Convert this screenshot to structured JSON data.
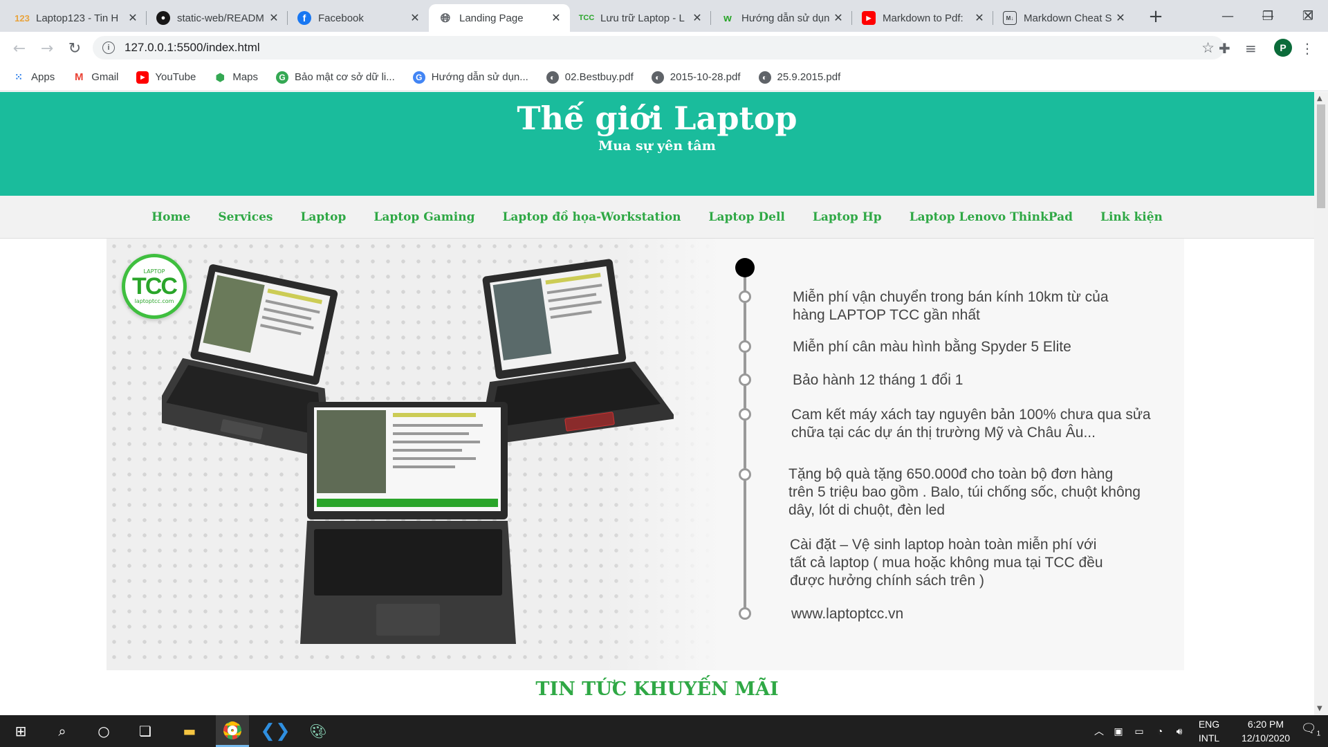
{
  "browser": {
    "tabs": [
      {
        "title": "Laptop123 - Tin H",
        "favicon": "laptop123-icon",
        "color": "#e8a33c"
      },
      {
        "title": "static-web/READM",
        "favicon": "github-icon",
        "color": "#181717"
      },
      {
        "title": "Facebook",
        "favicon": "facebook-icon",
        "color": "#1877f2"
      },
      {
        "title": "Landing Page",
        "favicon": "globe-icon",
        "color": "#5f6368",
        "active": true
      },
      {
        "title": "Lưu trữ Laptop - L",
        "favicon": "tcc-icon",
        "color": "#2aa52a"
      },
      {
        "title": "Hướng dẫn sử dụn",
        "favicon": "w-icon",
        "color": "#2aa52a"
      },
      {
        "title": "Markdown to Pdf:",
        "favicon": "youtube-icon",
        "color": "#ff0000"
      },
      {
        "title": "Markdown Cheat S",
        "favicon": "markdown-icon",
        "color": "#3c4043"
      }
    ],
    "url": "127.0.0.1:5500/index.html",
    "profile_initial": "P",
    "bookmarks": [
      {
        "label": "Apps",
        "icon": "apps-grid-icon"
      },
      {
        "label": "Gmail",
        "icon": "gmail-icon"
      },
      {
        "label": "YouTube",
        "icon": "youtube-icon"
      },
      {
        "label": "Maps",
        "icon": "maps-icon"
      },
      {
        "label": "Bảo mật cơ sở dữ li...",
        "icon": "green-g-icon"
      },
      {
        "label": "Hướng dẫn sử dụn...",
        "icon": "blue-g-icon"
      },
      {
        "label": "02.Bestbuy.pdf",
        "icon": "globe-icon"
      },
      {
        "label": "2015-10-28.pdf",
        "icon": "globe-icon"
      },
      {
        "label": "25.9.2015.pdf",
        "icon": "globe-icon"
      }
    ]
  },
  "site": {
    "title": "Thế giới Laptop",
    "subtitle": "Mua sự yên tâm",
    "nav": [
      "Home",
      "Services",
      "Laptop",
      "Laptop Gaming",
      "Laptop đồ họa-Workstation",
      "Laptop Dell",
      "Laptop Hp",
      "Laptop Lenovo ThinkPad",
      "Link kiện"
    ],
    "banner": {
      "logo_text": "TCC",
      "logo_top": "LAPTOP",
      "logo_sub": "laptoptcc.com",
      "features": [
        "Miễn phí vận chuyển trong bán kính 10km từ của hàng LAPTOP TCC gần nhất",
        "Miễn phí cân màu hình bằng Spyder 5 Elite",
        "Bảo hành 12 tháng 1 đổi 1",
        "Cam kết máy xách tay nguyên bản 100% chưa qua sửa chữa tại các dự án thị trường Mỹ và Châu Âu...",
        "Tặng bộ quà tặng 650.000đ cho toàn bộ đơn hàng trên 5 triệu bao gồm . Balo, túi chống sốc, chuột không dây, lót di chuột, đèn led",
        "Cài đặt – Vệ sinh laptop hoàn toàn miễn phí với tất cả laptop ( mua hoặc không mua tại TCC đều được hưởng chính sách trên )",
        "www.laptoptcc.vn"
      ]
    },
    "section_title": "TIN TỨC KHUYẾN MÃI",
    "accent": "#1abc9c",
    "link_color": "#2fa845"
  },
  "taskbar": {
    "lang_top": "ENG",
    "lang_bottom": "INTL",
    "time": "6:20 PM",
    "date": "12/10/2020",
    "notifications": "1"
  }
}
